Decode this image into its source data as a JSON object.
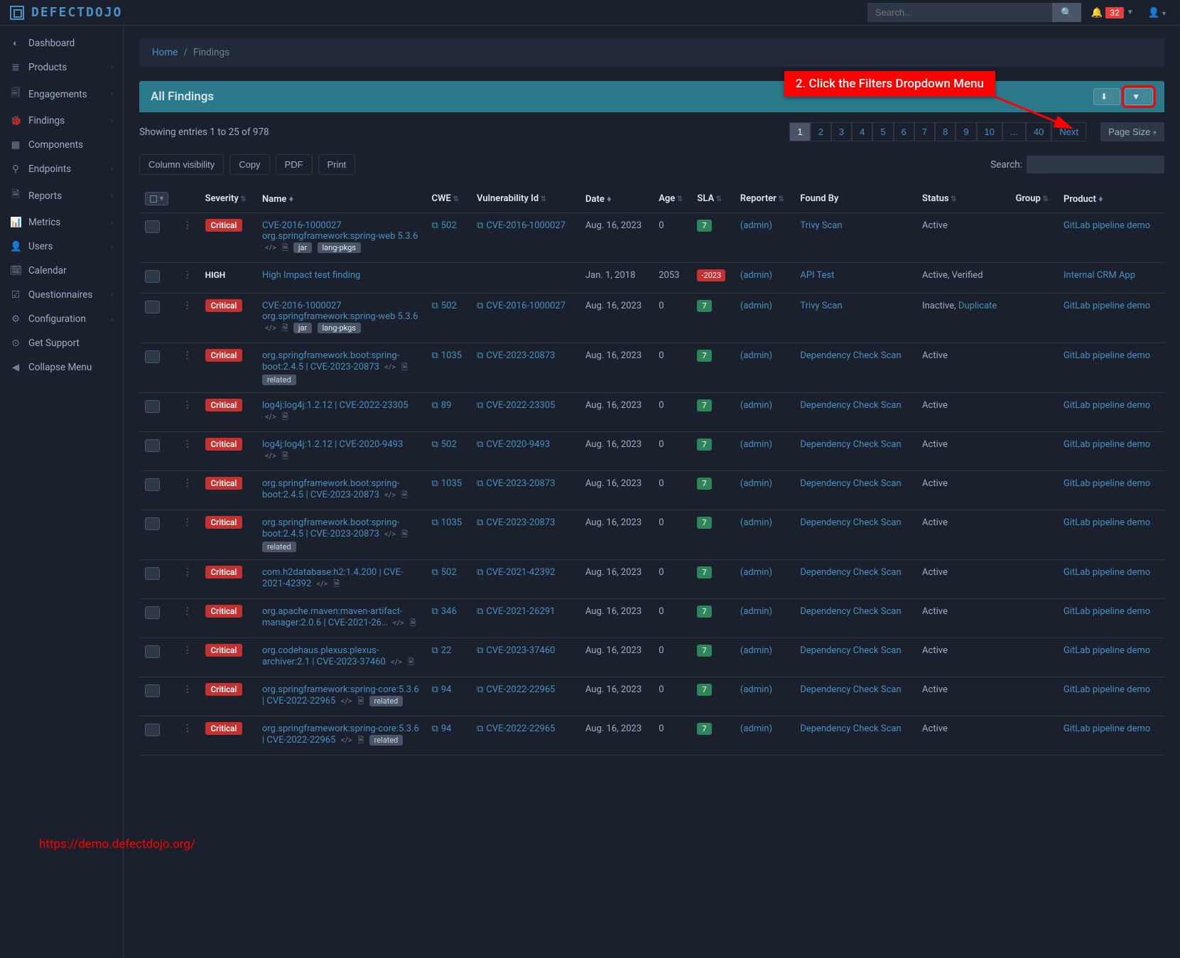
{
  "brand": "DEFECTDOJO",
  "topbar": {
    "search_placeholder": "Search...",
    "notif_count": "32"
  },
  "annotation": {
    "label": "2. Click the Filters Dropdown Menu",
    "url": "https://demo.defectdojo.org/"
  },
  "sidebar": [
    {
      "icon": "◐",
      "label": "Dashboard",
      "chev": false
    },
    {
      "icon": "≣",
      "label": "Products",
      "chev": true
    },
    {
      "icon": "🗐",
      "label": "Engagements",
      "chev": true
    },
    {
      "icon": "🐞",
      "label": "Findings",
      "chev": true
    },
    {
      "icon": "▦",
      "label": "Components",
      "chev": false
    },
    {
      "icon": "⚲",
      "label": "Endpoints",
      "chev": true
    },
    {
      "icon": "🗎",
      "label": "Reports",
      "chev": true
    },
    {
      "icon": "📊",
      "label": "Metrics",
      "chev": true
    },
    {
      "icon": "👤",
      "label": "Users",
      "chev": true
    },
    {
      "icon": "🗓",
      "label": "Calendar",
      "chev": false
    },
    {
      "icon": "☑",
      "label": "Questionnaires",
      "chev": true
    },
    {
      "icon": "⚙",
      "label": "Configuration",
      "chev": true
    },
    {
      "icon": "⊙",
      "label": "Get Support",
      "chev": false
    },
    {
      "icon": "◀",
      "label": "Collapse Menu",
      "chev": false
    }
  ],
  "breadcrumb": {
    "home": "Home",
    "sep": "/",
    "current": "Findings"
  },
  "panel": {
    "title": "All Findings",
    "page_size": "Page Size"
  },
  "entries_text": "Showing entries 1 to 25 of 978",
  "pagination": [
    "1",
    "2",
    "3",
    "4",
    "5",
    "6",
    "7",
    "8",
    "9",
    "10",
    "...",
    "40",
    "Next"
  ],
  "tools": {
    "colvis": "Column visibility",
    "copy": "Copy",
    "pdf": "PDF",
    "print": "Print",
    "search_label": "Search:"
  },
  "columns": {
    "severity": "Severity",
    "name": "Name",
    "cwe": "CWE",
    "vuln": "Vulnerability Id",
    "date": "Date",
    "age": "Age",
    "sla": "SLA",
    "reporter": "Reporter",
    "found_by": "Found By",
    "status": "Status",
    "group": "Group",
    "product": "Product"
  },
  "rows": [
    {
      "sev": "Critical",
      "name": "CVE-2016-1000027 org.springframework:spring-web 5.3.6",
      "tags": [
        "jar",
        "lang-pkgs"
      ],
      "code": true,
      "cwe": "502",
      "vuln": "CVE-2016-1000027",
      "date": "Aug. 16, 2023",
      "age": "0",
      "sla": "7",
      "reporter": "(admin)",
      "found": "Trivy Scan",
      "status": "Active",
      "product": "GitLab pipeline demo"
    },
    {
      "sev": "HIGH",
      "name": "High Impact test finding",
      "tags": [],
      "code": false,
      "cwe": "",
      "vuln": "",
      "date": "Jan. 1, 2018",
      "age": "2053",
      "sla": "-2023",
      "reporter": "(admin)",
      "found": "API Test",
      "status": "Active, Verified",
      "product": "Internal CRM App"
    },
    {
      "sev": "Critical",
      "name": "CVE-2016-1000027 org.springframework:spring-web 5.3.6",
      "tags": [
        "jar",
        "lang-pkgs"
      ],
      "code": true,
      "cwe": "502",
      "vuln": "CVE-2016-1000027",
      "date": "Aug. 16, 2023",
      "age": "0",
      "sla": "7",
      "reporter": "(admin)",
      "found": "Trivy Scan",
      "status": "Inactive, Duplicate",
      "product": "GitLab pipeline demo"
    },
    {
      "sev": "Critical",
      "name": "org.springframework.boot:spring-boot:2.4.5 | CVE-2023-20873",
      "tags": [
        "related"
      ],
      "code": true,
      "cwe": "1035",
      "vuln": "CVE-2023-20873",
      "date": "Aug. 16, 2023",
      "age": "0",
      "sla": "7",
      "reporter": "(admin)",
      "found": "Dependency Check Scan",
      "status": "Active",
      "product": "GitLab pipeline demo"
    },
    {
      "sev": "Critical",
      "name": "log4j:log4j:1.2.12 | CVE-2022-23305",
      "tags": [],
      "code": true,
      "cwe": "89",
      "vuln": "CVE-2022-23305",
      "date": "Aug. 16, 2023",
      "age": "0",
      "sla": "7",
      "reporter": "(admin)",
      "found": "Dependency Check Scan",
      "status": "Active",
      "product": "GitLab pipeline demo"
    },
    {
      "sev": "Critical",
      "name": "log4j:log4j:1.2.12 | CVE-2020-9493",
      "tags": [],
      "code": true,
      "cwe": "502",
      "vuln": "CVE-2020-9493",
      "date": "Aug. 16, 2023",
      "age": "0",
      "sla": "7",
      "reporter": "(admin)",
      "found": "Dependency Check Scan",
      "status": "Active",
      "product": "GitLab pipeline demo"
    },
    {
      "sev": "Critical",
      "name": "org.springframework.boot:spring-boot:2.4.5 | CVE-2023-20873",
      "tags": [],
      "code": true,
      "cwe": "1035",
      "vuln": "CVE-2023-20873",
      "date": "Aug. 16, 2023",
      "age": "0",
      "sla": "7",
      "reporter": "(admin)",
      "found": "Dependency Check Scan",
      "status": "Active",
      "product": "GitLab pipeline demo"
    },
    {
      "sev": "Critical",
      "name": "org.springframework.boot:spring-boot:2.4.5 | CVE-2023-20873",
      "tags": [
        "related"
      ],
      "code": true,
      "cwe": "1035",
      "vuln": "CVE-2023-20873",
      "date": "Aug. 16, 2023",
      "age": "0",
      "sla": "7",
      "reporter": "(admin)",
      "found": "Dependency Check Scan",
      "status": "Active",
      "product": "GitLab pipeline demo"
    },
    {
      "sev": "Critical",
      "name": "com.h2database:h2:1.4.200 | CVE-2021-42392",
      "tags": [],
      "code": true,
      "cwe": "502",
      "vuln": "CVE-2021-42392",
      "date": "Aug. 16, 2023",
      "age": "0",
      "sla": "7",
      "reporter": "(admin)",
      "found": "Dependency Check Scan",
      "status": "Active",
      "product": "GitLab pipeline demo"
    },
    {
      "sev": "Critical",
      "name": "org.apache.maven:maven-artifact-manager:2.0.6 | CVE-2021-26…",
      "tags": [],
      "code": true,
      "cwe": "346",
      "vuln": "CVE-2021-26291",
      "date": "Aug. 16, 2023",
      "age": "0",
      "sla": "7",
      "reporter": "(admin)",
      "found": "Dependency Check Scan",
      "status": "Active",
      "product": "GitLab pipeline demo"
    },
    {
      "sev": "Critical",
      "name": "org.codehaus.plexus:plexus-archiver:2.1 | CVE-2023-37460",
      "tags": [],
      "code": true,
      "cwe": "22",
      "vuln": "CVE-2023-37460",
      "date": "Aug. 16, 2023",
      "age": "0",
      "sla": "7",
      "reporter": "(admin)",
      "found": "Dependency Check Scan",
      "status": "Active",
      "product": "GitLab pipeline demo"
    },
    {
      "sev": "Critical",
      "name": "org.springframework:spring-core:5.3.6 | CVE-2022-22965",
      "tags": [
        "related"
      ],
      "code": true,
      "cwe": "94",
      "vuln": "CVE-2022-22965",
      "date": "Aug. 16, 2023",
      "age": "0",
      "sla": "7",
      "reporter": "(admin)",
      "found": "Dependency Check Scan",
      "status": "Active",
      "product": "GitLab pipeline demo"
    },
    {
      "sev": "Critical",
      "name": "org.springframework:spring-core:5.3.6 | CVE-2022-22965",
      "tags": [
        "related"
      ],
      "code": true,
      "cwe": "94",
      "vuln": "CVE-2022-22965",
      "date": "Aug. 16, 2023",
      "age": "0",
      "sla": "7",
      "reporter": "(admin)",
      "found": "Dependency Check Scan",
      "status": "Active",
      "product": "GitLab pipeline demo"
    }
  ]
}
